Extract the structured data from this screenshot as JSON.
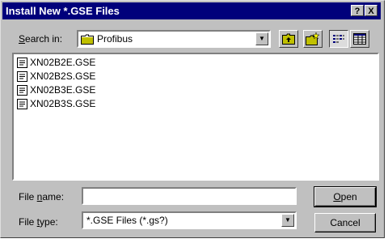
{
  "window": {
    "title": "Install New *.GSE Files",
    "help_label": "?",
    "close_label": "X"
  },
  "lookin": {
    "label_prefix": "S",
    "label_rest": "earch in:",
    "value": "Profibus"
  },
  "toolbar": {
    "buttons": [
      "up-one-level",
      "create-new-folder",
      "list-view",
      "details-view"
    ]
  },
  "files": [
    {
      "name": "XN02B2E.GSE"
    },
    {
      "name": "XN02B2S.GSE"
    },
    {
      "name": "XN02B3E.GSE"
    },
    {
      "name": "XN02B3S.GSE"
    }
  ],
  "filename": {
    "label_pre": "File ",
    "label_u": "n",
    "label_post": "ame:",
    "value": ""
  },
  "filetype": {
    "label_pre": "File ",
    "label_u": "t",
    "label_post": "ype:",
    "value": "*.GSE Files (*.gs?)"
  },
  "buttons": {
    "open_pre": "",
    "open_u": "O",
    "open_post": "pen",
    "cancel": "Cancel"
  }
}
